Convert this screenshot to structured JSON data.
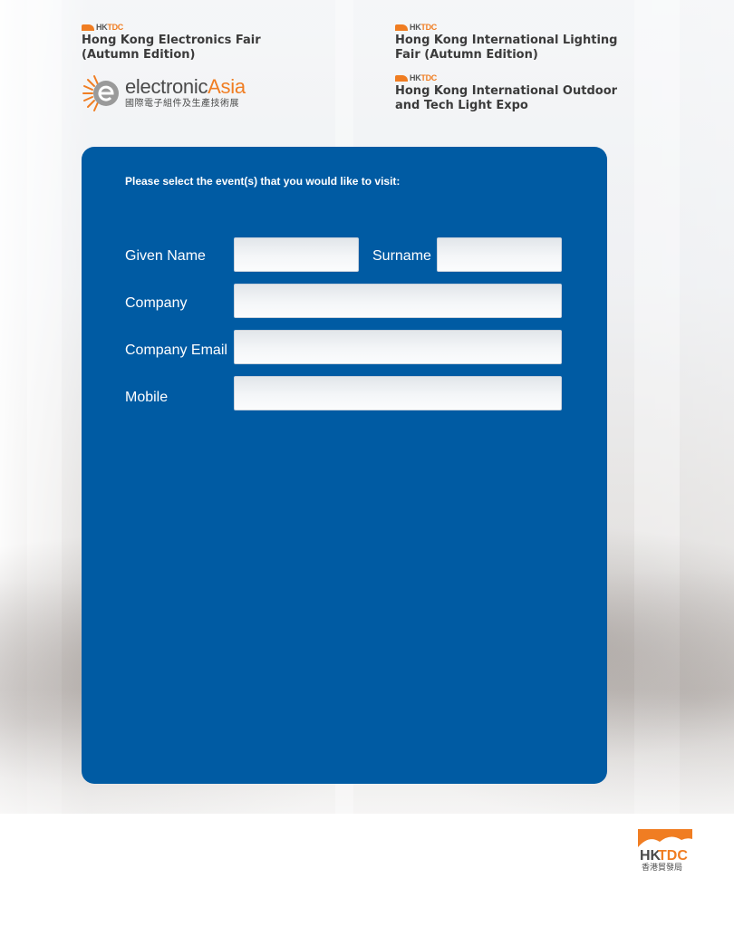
{
  "header": {
    "events": [
      {
        "brand_hk": "HK",
        "brand_tdc": "TDC",
        "title_line1": "Hong Kong Electronics Fair",
        "title_line2": "(Autumn Edition)"
      },
      {
        "brand_hk": "HK",
        "brand_tdc": "TDC",
        "title_line1": "Hong Kong International Lighting",
        "title_line2": "Fair (Autumn Edition)"
      },
      {
        "brand_hk": "HK",
        "brand_tdc": "TDC",
        "title_line1": "Hong Kong International Outdoor",
        "title_line2": "and Tech Light Expo"
      }
    ],
    "electronic_asia": {
      "name_part1": "electronic",
      "name_part2": "Asia",
      "chinese": "國際電子組件及生產技術展"
    }
  },
  "form": {
    "instruction": "Please select the event(s) that you would like to visit:",
    "given_name": {
      "label": "Given Name",
      "value": "",
      "placeholder": ""
    },
    "surname": {
      "label": "Surname",
      "value": "",
      "placeholder": ""
    },
    "company": {
      "label": "Company",
      "value": "",
      "placeholder": ""
    },
    "company_email": {
      "label": "Company Email",
      "value": "",
      "placeholder": ""
    },
    "mobile": {
      "label": "Mobile",
      "value": "",
      "placeholder": ""
    }
  },
  "footer": {
    "logo_hk": "HK",
    "logo_tdc": "TDC",
    "logo_chinese": "香港貿發局"
  },
  "colors": {
    "panel_blue": "#005ba3",
    "brand_orange": "#f07d22",
    "logo_grey": "#3b3b3b"
  }
}
